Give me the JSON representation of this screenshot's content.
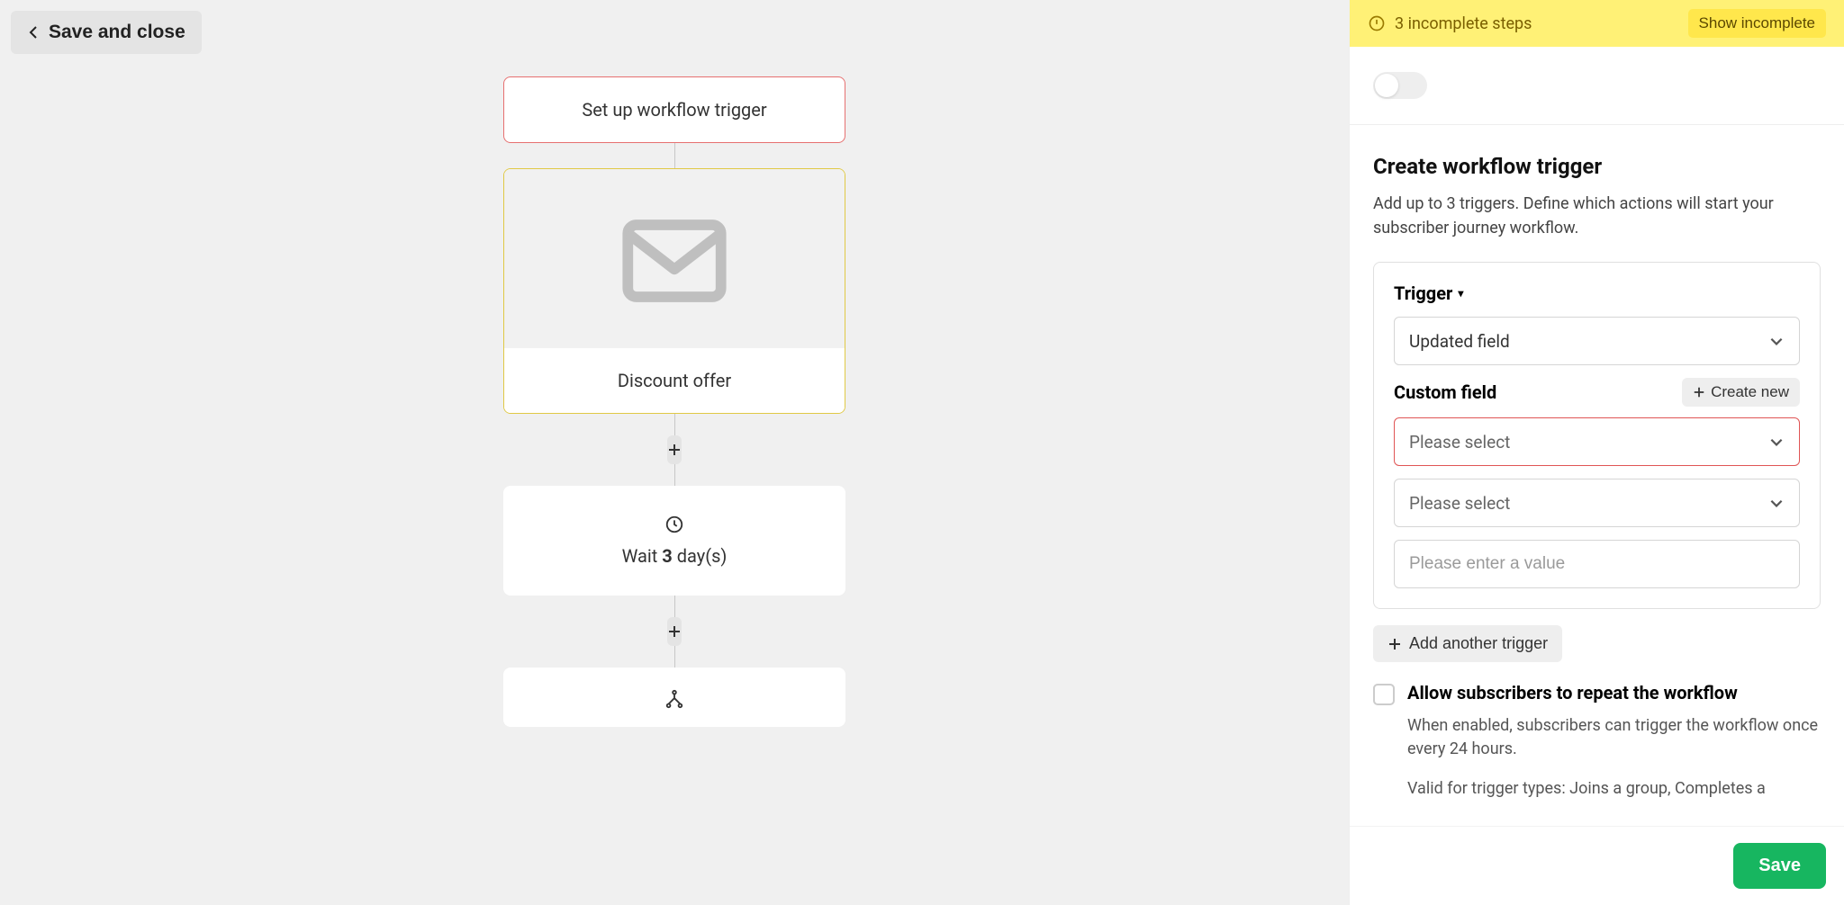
{
  "header": {
    "save_close_label": "Save and close"
  },
  "workflow": {
    "trigger_node_label": "Set up workflow trigger",
    "email_node_label": "Discount offer",
    "wait_label_prefix": "Wait ",
    "wait_days": "3",
    "wait_label_suffix": " day(s)"
  },
  "banner": {
    "incomplete_text": "3 incomplete steps",
    "show_incomplete_label": "Show incomplete"
  },
  "panel": {
    "title": "Create workflow trigger",
    "description": "Add up to 3 triggers. Define which actions will start your subscriber journey workflow.",
    "trigger_label": "Trigger",
    "trigger_select_value": "Updated field",
    "custom_field_label": "Custom field",
    "create_new_label": "Create new",
    "custom_field_select_placeholder": "Please select",
    "operator_select_placeholder": "Please select",
    "value_input_placeholder": "Please enter a value",
    "add_trigger_label": "Add another trigger",
    "repeat_checkbox_label": "Allow subscribers to repeat the workflow",
    "repeat_desc": "When enabled, subscribers can trigger the workflow once every 24 hours.",
    "repeat_valid": "Valid for trigger types: Joins a group, Completes a"
  },
  "footer": {
    "save_label": "Save"
  }
}
